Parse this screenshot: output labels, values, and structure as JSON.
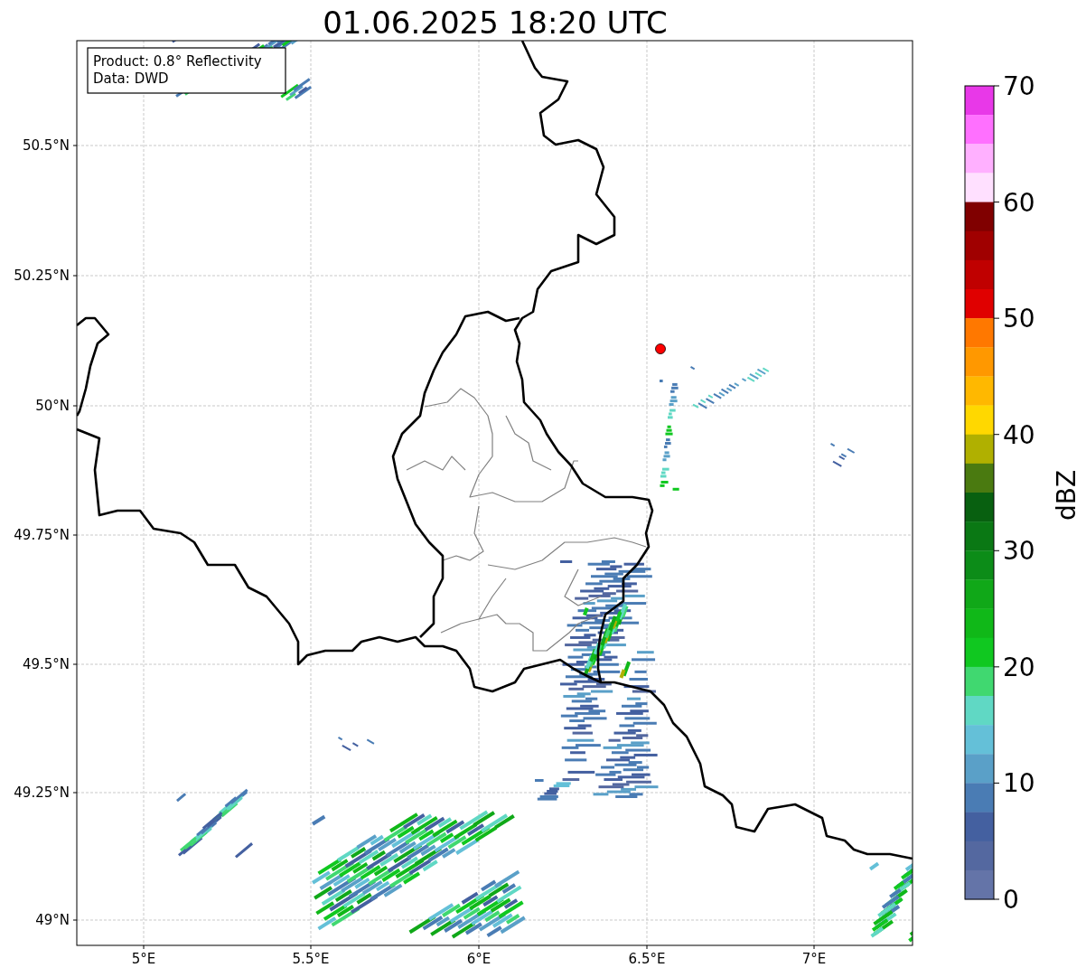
{
  "title": "01.06.2025 18:20 UTC",
  "info_box": [
    "Product: 0.8° Reflectivity",
    "Data: DWD"
  ],
  "map": {
    "lat_labels": [
      "50.5°N",
      "50.25°N",
      "50°N",
      "49.75°N",
      "49.5°N",
      "49.25°N",
      "49°N"
    ],
    "lon_labels": [
      "5°E",
      "5.5°E",
      "6°E",
      "6.5°E",
      "7°E"
    ]
  },
  "colorbar": {
    "label": "dBZ",
    "ticks": [
      "70",
      "60",
      "50",
      "40",
      "30",
      "20",
      "10",
      "0"
    ],
    "segments": [
      {
        "color": "#e838e8"
      },
      {
        "color": "#ff70ff"
      },
      {
        "color": "#ffb0ff"
      },
      {
        "color": "#ffe0ff"
      },
      {
        "color": "#800000"
      },
      {
        "color": "#a00000"
      },
      {
        "color": "#c00000"
      },
      {
        "color": "#e00000"
      },
      {
        "color": "#ff7800"
      },
      {
        "color": "#ff9800"
      },
      {
        "color": "#ffb800"
      },
      {
        "color": "#ffd800"
      },
      {
        "color": "#b0b000"
      },
      {
        "color": "#4a7a10"
      },
      {
        "color": "#086010"
      },
      {
        "color": "#0a7814"
      },
      {
        "color": "#0c8c18"
      },
      {
        "color": "#10a818"
      },
      {
        "color": "#10b818"
      },
      {
        "color": "#10c820"
      },
      {
        "color": "#40d870"
      },
      {
        "color": "#60d8c4"
      },
      {
        "color": "#64c0d8"
      },
      {
        "color": "#5aa0c8"
      },
      {
        "color": "#4a7cb4"
      },
      {
        "color": "#4460a0"
      },
      {
        "color": "#5468a0"
      },
      {
        "color": "#6474a8"
      }
    ]
  }
}
